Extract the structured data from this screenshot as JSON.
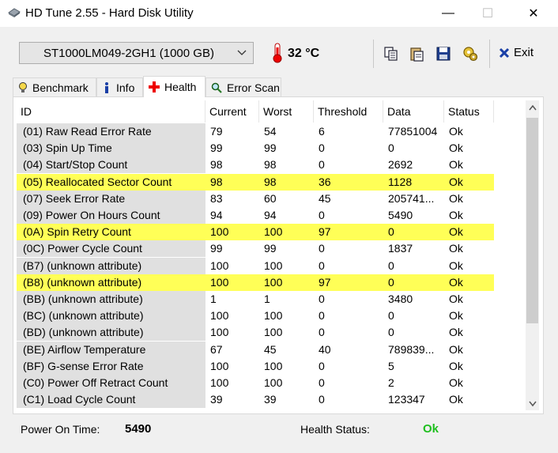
{
  "window": {
    "title": "HD Tune 2.55 - Hard Disk Utility",
    "minimize": "—",
    "maximize": "☐",
    "close": "✕"
  },
  "toolbar": {
    "drive": "ST1000LM049-2GH1 (1000 GB)",
    "temperature": "32 °C",
    "exit_label": "Exit"
  },
  "tabs": [
    {
      "label": "Benchmark"
    },
    {
      "label": "Info"
    },
    {
      "label": "Health"
    },
    {
      "label": "Error Scan"
    }
  ],
  "table": {
    "columns": [
      "ID",
      "Current",
      "Worst",
      "Threshold",
      "Data",
      "Status"
    ],
    "rows": [
      {
        "id": "(01) Raw Read Error Rate",
        "current": "79",
        "worst": "54",
        "threshold": "6",
        "data": "77851004",
        "status": "Ok",
        "highlight": false
      },
      {
        "id": "(03) Spin Up Time",
        "current": "99",
        "worst": "99",
        "threshold": "0",
        "data": "0",
        "status": "Ok",
        "highlight": false
      },
      {
        "id": "(04) Start/Stop Count",
        "current": "98",
        "worst": "98",
        "threshold": "0",
        "data": "2692",
        "status": "Ok",
        "highlight": false
      },
      {
        "id": "(05) Reallocated Sector Count",
        "current": "98",
        "worst": "98",
        "threshold": "36",
        "data": "1128",
        "status": "Ok",
        "highlight": true
      },
      {
        "id": "(07) Seek Error Rate",
        "current": "83",
        "worst": "60",
        "threshold": "45",
        "data": "205741...",
        "status": "Ok",
        "highlight": false
      },
      {
        "id": "(09) Power On Hours Count",
        "current": "94",
        "worst": "94",
        "threshold": "0",
        "data": "5490",
        "status": "Ok",
        "highlight": false
      },
      {
        "id": "(0A) Spin Retry Count",
        "current": "100",
        "worst": "100",
        "threshold": "97",
        "data": "0",
        "status": "Ok",
        "highlight": true
      },
      {
        "id": "(0C) Power Cycle Count",
        "current": "99",
        "worst": "99",
        "threshold": "0",
        "data": "1837",
        "status": "Ok",
        "highlight": false
      },
      {
        "id": "(B7) (unknown attribute)",
        "current": "100",
        "worst": "100",
        "threshold": "0",
        "data": "0",
        "status": "Ok",
        "highlight": false
      },
      {
        "id": "(B8) (unknown attribute)",
        "current": "100",
        "worst": "100",
        "threshold": "97",
        "data": "0",
        "status": "Ok",
        "highlight": true
      },
      {
        "id": "(BB) (unknown attribute)",
        "current": "1",
        "worst": "1",
        "threshold": "0",
        "data": "3480",
        "status": "Ok",
        "highlight": false
      },
      {
        "id": "(BC) (unknown attribute)",
        "current": "100",
        "worst": "100",
        "threshold": "0",
        "data": "0",
        "status": "Ok",
        "highlight": false
      },
      {
        "id": "(BD) (unknown attribute)",
        "current": "100",
        "worst": "100",
        "threshold": "0",
        "data": "0",
        "status": "Ok",
        "highlight": false
      },
      {
        "id": "(BE) Airflow Temperature",
        "current": "67",
        "worst": "45",
        "threshold": "40",
        "data": "789839...",
        "status": "Ok",
        "highlight": false
      },
      {
        "id": "(BF) G-sense Error Rate",
        "current": "100",
        "worst": "100",
        "threshold": "0",
        "data": "5",
        "status": "Ok",
        "highlight": false
      },
      {
        "id": "(C0) Power Off Retract Count",
        "current": "100",
        "worst": "100",
        "threshold": "0",
        "data": "2",
        "status": "Ok",
        "highlight": false
      },
      {
        "id": "(C1) Load Cycle Count",
        "current": "39",
        "worst": "39",
        "threshold": "0",
        "data": "123347",
        "status": "Ok",
        "highlight": false
      }
    ]
  },
  "footer": {
    "power_on_label": "Power On Time:",
    "power_on_value": "5490",
    "health_label": "Health Status:",
    "health_value": "Ok"
  },
  "colors": {
    "highlight": "#ffff57",
    "ok_green": "#1fbf1f",
    "id_column_bg": "#e0e0e0"
  }
}
